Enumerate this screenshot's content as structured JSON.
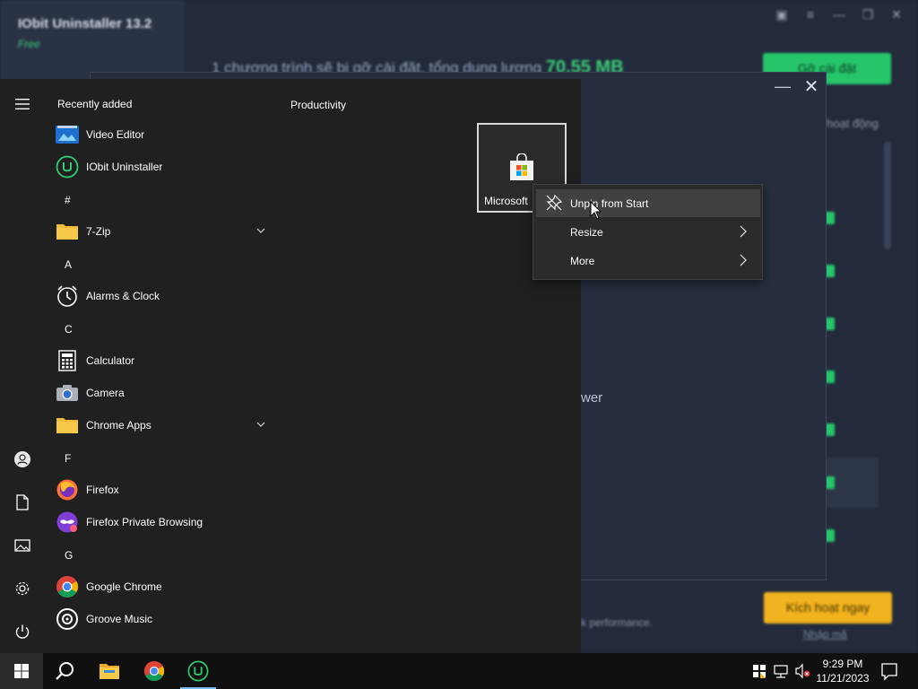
{
  "background_app": {
    "title": "IObit Uninstaller 13.2",
    "subtitle": "Free",
    "headline_prefix": "1 chương trình sẽ bị gỡ cài đặt, tổng dung lượng",
    "headline_size": "70.55 MB",
    "uninstall_button": "Gỡ cài đặt",
    "column_header": "hoạt động",
    "activate_button": "Kích hoạt ngay",
    "activate_link": "Nhập mã",
    "footer_text": "k performance.",
    "dialog_fragment": "wer"
  },
  "start_menu": {
    "recent_title": "Recently added",
    "apps": [
      {
        "label": "Video Editor",
        "icon": "video-editor-icon"
      },
      {
        "label": "IObit Uninstaller",
        "icon": "iobit-uninstaller-icon"
      },
      {
        "letter": "#"
      },
      {
        "label": "7-Zip",
        "icon": "folder-icon",
        "expandable": true
      },
      {
        "letter": "A"
      },
      {
        "label": "Alarms & Clock",
        "icon": "alarm-clock-icon"
      },
      {
        "letter": "C"
      },
      {
        "label": "Calculator",
        "icon": "calculator-icon"
      },
      {
        "label": "Camera",
        "icon": "camera-icon"
      },
      {
        "label": "Chrome Apps",
        "icon": "folder-icon",
        "expandable": true
      },
      {
        "letter": "F"
      },
      {
        "label": "Firefox",
        "icon": "firefox-icon"
      },
      {
        "label": "Firefox Private Browsing",
        "icon": "firefox-private-icon"
      },
      {
        "letter": "G"
      },
      {
        "label": "Google Chrome",
        "icon": "chrome-icon"
      },
      {
        "label": "Groove Music",
        "icon": "groove-music-icon"
      }
    ],
    "tile_group": "Productivity",
    "tile_label": "Microsoft"
  },
  "context_menu": {
    "items": [
      {
        "label": "Unpin from Start",
        "icon": "unpin-icon",
        "highlighted": true
      },
      {
        "label": "Resize",
        "submenu": true
      },
      {
        "label": "More",
        "submenu": true
      }
    ]
  },
  "taskbar": {
    "time": "9:29 PM",
    "date": "11/21/2023"
  },
  "colors": {
    "start_bg": "#202020",
    "taskbar_bg": "#101010",
    "accent_green": "#26c56a",
    "accent_orange": "#f2b320"
  }
}
